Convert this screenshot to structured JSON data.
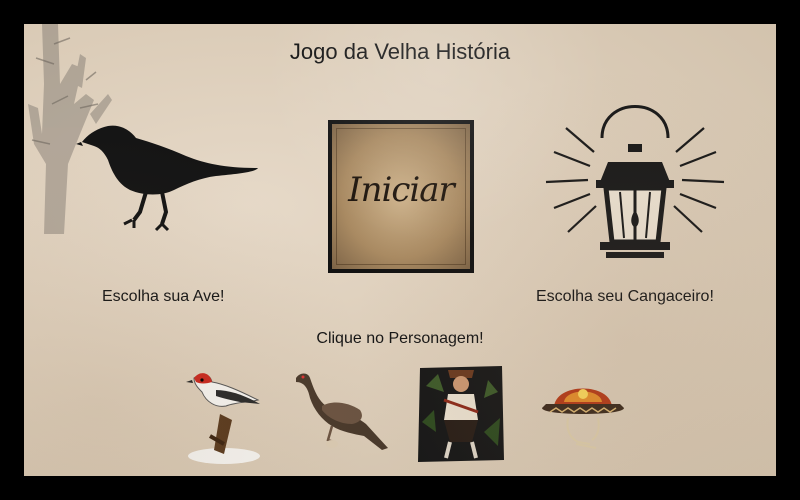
{
  "game": {
    "title": "Jogo da Velha História",
    "start_label": "Iniciar",
    "choose_bird_label": "Escolha sua Ave!",
    "choose_cangaceiro_label": "Escolha seu Cangaceiro!",
    "click_character_label": "Clique no Personagem!"
  },
  "icons": {
    "decor": "cactus-icon",
    "bird_choice": "bird-silhouette-icon",
    "cangaceiro_choice": "lantern-icon",
    "characters": [
      "cardinal-bird-icon",
      "jacu-bird-icon",
      "cangaceiro-figure-icon",
      "cangaceiro-hat-icon"
    ]
  },
  "colors": {
    "page_border": "#000000",
    "paper": "#dccdb9",
    "text": "#161616",
    "start_button": "#a98a62"
  }
}
